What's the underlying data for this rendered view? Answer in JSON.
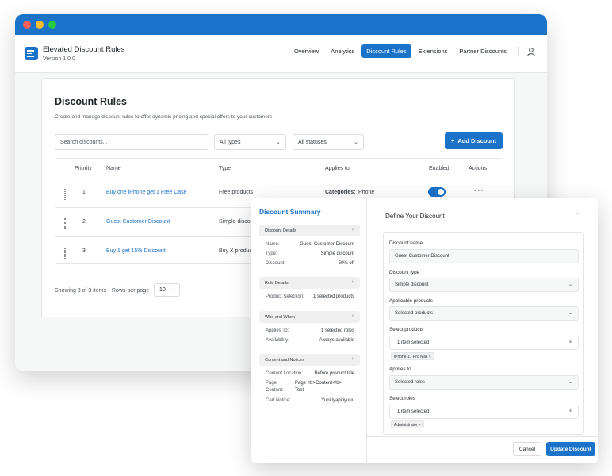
{
  "app": {
    "title": "Elevated Discount Rules",
    "version": "Version 1.0.0",
    "logo_icon": "rules-logo-icon",
    "accent": "#1a73c9"
  },
  "nav": {
    "items": [
      {
        "label": "Overview",
        "active": false
      },
      {
        "label": "Analytics",
        "active": false
      },
      {
        "label": "Discount Rules",
        "active": true
      },
      {
        "label": "Extensions",
        "active": false
      },
      {
        "label": "Partner Discounts",
        "active": false
      }
    ],
    "user_icon": "user-icon"
  },
  "page": {
    "title": "Discount Rules",
    "subtitle": "Create and manage discount rules to offer dynamic pricing and special offers to your customers"
  },
  "filters": {
    "search_placeholder": "Search discounts...",
    "type_select": "All types",
    "status_select": "All statuses",
    "add_button": "Add Discount",
    "add_icon": "plus-icon"
  },
  "table": {
    "headers": [
      "Priority",
      "Name",
      "Type",
      "Applies to",
      "Enabled",
      "Actions"
    ],
    "rows": [
      {
        "priority": "1",
        "name": "Buy one iPhone get 1 Free Case",
        "type": "Free products",
        "applies_label": "Categories:",
        "applies_value": "iPhone",
        "enabled": true
      },
      {
        "priority": "2",
        "name": "Guest Customer Discount",
        "type": "Simple disco",
        "applies_label": "",
        "applies_value": "",
        "enabled": true
      },
      {
        "priority": "3",
        "name": "Buy 1 get 15% Discount",
        "type": "Buy X produc",
        "applies_label": "",
        "applies_value": "",
        "enabled": true
      }
    ],
    "actions_icon": "more-dots-icon"
  },
  "pagination": {
    "showing": "Showing 3 of 3 items",
    "rows_per_page_label": "Rows per page",
    "rows_per_page_value": "10"
  },
  "summary": {
    "title": "Discount Summary",
    "sections": [
      {
        "title": "Discount Details",
        "items": [
          {
            "k": "Name:",
            "v": "Guest Customer Discount"
          },
          {
            "k": "Type:",
            "v": "Simple discount"
          },
          {
            "k": "Discount:",
            "v": "50% off"
          }
        ]
      },
      {
        "title": "Rule Details",
        "items": [
          {
            "k": "Product Selection:",
            "v": "1 selected products"
          }
        ]
      },
      {
        "title": "Who and When",
        "items": [
          {
            "k": "Applies To:",
            "v": "1 selected roles"
          },
          {
            "k": "Availability:",
            "v": "Always available"
          }
        ]
      },
      {
        "title": "Content and Notices",
        "items": [
          {
            "k": "Content Location:",
            "v": "Before product title"
          },
          {
            "k": "Page",
            "v": "Page <b>Content</b>"
          },
          {
            "k": "Content:",
            "v": "Test"
          },
          {
            "k": "Cart Notice:",
            "v": "Yupitiyapitiyuuu"
          }
        ]
      }
    ]
  },
  "define": {
    "title": "Define Your Discount",
    "fields": {
      "name_label": "Discount name",
      "name_value": "Guest Customer Discount",
      "type_label": "Discount type",
      "type_value": "Simple discount",
      "products_label": "Applicable products",
      "products_value": "Selected products",
      "select_products_label": "Select products",
      "select_products_value": "1 item selected",
      "product_tag": "iPhone 17 Pro Max",
      "applies_label": "Applies to",
      "applies_value": "Selected roles",
      "select_roles_label": "Select roles",
      "select_roles_value": "1 item selected",
      "role_tag": "Administrator"
    },
    "cancel": "Cancel",
    "update": "Update Discount"
  }
}
